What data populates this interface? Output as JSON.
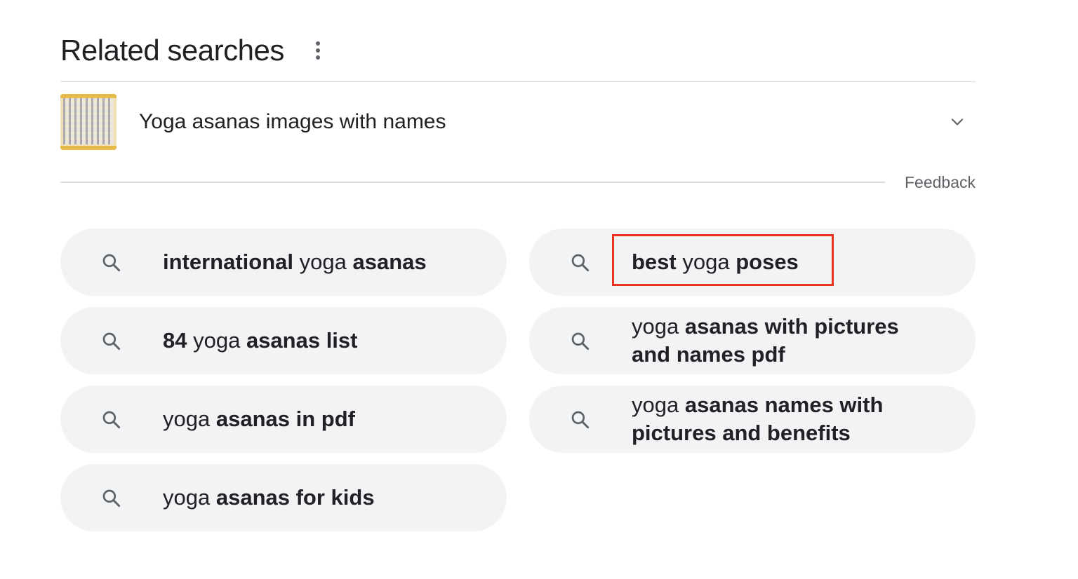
{
  "header": {
    "title": "Related searches",
    "more_icon": "more-vert-icon"
  },
  "image_result": {
    "label": "Yoga asanas images with names",
    "thumbnail_icon": "yoga-poses-chart-thumbnail",
    "expand_icon": "chevron-down-icon"
  },
  "feedback_label": "Feedback",
  "chips": [
    {
      "parts": [
        {
          "t": "international",
          "b": true
        },
        {
          "t": " yoga ",
          "b": false
        },
        {
          "t": "asanas",
          "b": true
        }
      ]
    },
    {
      "parts": [
        {
          "t": "best",
          "b": true
        },
        {
          "t": " yoga ",
          "b": false
        },
        {
          "t": "poses",
          "b": true
        }
      ],
      "highlighted": true
    },
    {
      "parts": [
        {
          "t": "84",
          "b": true
        },
        {
          "t": " yoga ",
          "b": false
        },
        {
          "t": "asanas list",
          "b": true
        }
      ]
    },
    {
      "parts": [
        {
          "t": "yoga ",
          "b": false
        },
        {
          "t": "asanas with pictures and names pdf",
          "b": true
        }
      ]
    },
    {
      "parts": [
        {
          "t": "yoga ",
          "b": false
        },
        {
          "t": "asanas in pdf",
          "b": true
        }
      ]
    },
    {
      "parts": [
        {
          "t": "yoga ",
          "b": false
        },
        {
          "t": "asanas names with pictures and benefits",
          "b": true
        }
      ]
    },
    {
      "parts": [
        {
          "t": "yoga ",
          "b": false
        },
        {
          "t": "asanas for kids",
          "b": true
        }
      ]
    }
  ],
  "colors": {
    "chip_bg": "#f1f3f4",
    "highlight_box": "#e8321e",
    "text": "#202124",
    "muted": "#5f6368"
  }
}
